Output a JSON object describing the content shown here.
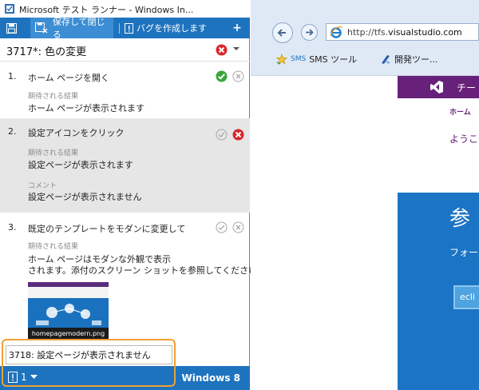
{
  "runner": {
    "title": "Microsoft テスト ランナー - Windows In...",
    "toolbar": {
      "save_close_label": "保存して閉じる",
      "create_bug_label": "バグを作成します"
    },
    "test_case": {
      "title": "3717*: 色の変更"
    },
    "steps": [
      {
        "number": "1.",
        "action": "ホーム ページを開く",
        "expected_label": "期待される結果",
        "expected": "ホーム ページが表示されます",
        "status": "passed"
      },
      {
        "number": "2.",
        "action": "設定アイコンをクリック",
        "expected_label": "期待される結果",
        "expected": "設定ページが表示されます",
        "comment_label": "コメント",
        "comment": "設定ページが表示されません",
        "status": "failed"
      },
      {
        "number": "3.",
        "action": "既定のテンプレートをモダンに変更して",
        "expected_label": "期待される結果",
        "expected_line1": "ホーム ページはモダンな外観で表示",
        "expected_line2": "されます。添付のスクリーン ショットを参照してください。",
        "attachment": "homepagemodern.png",
        "status": "none"
      }
    ],
    "comment_input_value": "3718: 設定ページが表示されません",
    "status_bar": {
      "bug_count": "1",
      "platform": "Windows 8"
    }
  },
  "browser": {
    "url_prefix": "http://tfs.",
    "url_domain": "visualstudio.com",
    "favorites": [
      {
        "icon_text": "SMS",
        "label": "SMS ツール"
      },
      {
        "label": "開発ツー..."
      }
    ],
    "site": {
      "team_label": "チー",
      "home_label": "ホーム",
      "welcome": "ようこ",
      "hero_title": "参",
      "hero_sub": "フォー",
      "button_label": "ecli"
    }
  },
  "colors": {
    "accent_blue": "#1e73be",
    "vs_purple": "#68217a",
    "fail_red": "#d9262a",
    "pass_green": "#3aa63a",
    "highlight_orange": "#f0a033"
  }
}
